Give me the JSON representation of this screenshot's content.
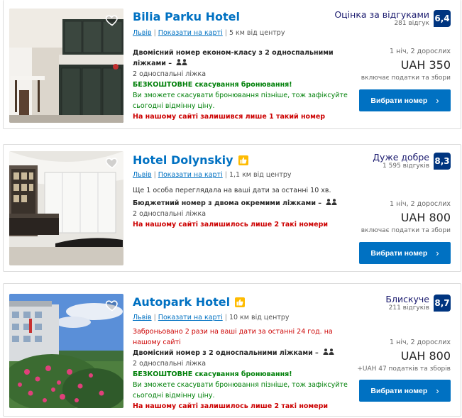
{
  "hotels": [
    {
      "name": "Bilia Parku Hotel",
      "city": "Львів",
      "map_link": "Показати на карті",
      "distance": "5 км від центру",
      "room_name": "Двомісний номер економ-класу з 2 односпальними ліжками –",
      "beds": "2 односпальні ліжка",
      "free_cancel": "БЕЗКОШТОВНЕ скасування бронювання!",
      "cancel_note": "Ви зможете скасувати бронювання пізніше, тож зафіксуйте сьогодні відмінну ціну.",
      "scarcity": "На нашому сайті залишився лише 1 такий номер",
      "review_word": "Оцінка за відгуками",
      "review_count": "281 відгук",
      "score": "6,4",
      "occupancy": "1 ніч, 2 дорослих",
      "price": "UAH 350",
      "tax": "включає податки та збори",
      "button": "Вибрати номер"
    },
    {
      "name": "Hotel Dolynskiy",
      "city": "Львів",
      "map_link": "Показати на карті",
      "distance": "1,1 км від центру",
      "viewers": "Ще 1 особа переглядала на ваші дати за останні 10 хв.",
      "room_name": "Бюджетний номер з двома окремими ліжками –",
      "beds": "2 односпальні ліжка",
      "scarcity": "На нашому сайті залишилось лише 2 такі номери",
      "review_word": "Дуже добре",
      "review_count": "1 595 відгуків",
      "score": "8,3",
      "occupancy": "1 ніч, 2 дорослих",
      "price": "UAH 800",
      "tax": "включає податки та збори",
      "button": "Вибрати номер"
    },
    {
      "name": "Autopark Hotel",
      "city": "Львів",
      "map_link": "Показати на карті",
      "distance": "10 км від центру",
      "booked_note": "Заброньовано 2 рази на ваші дати за останні 24 год. на нашому сайті",
      "room_name": "Двомісний номер з 2 односпальними ліжками –",
      "beds": "2 односпальні ліжка",
      "free_cancel": "БЕЗКОШТОВНЕ скасування бронювання!",
      "cancel_note": "Ви зможете скасувати бронювання пізніше, тож зафіксуйте сьогодні відмінну ціну.",
      "scarcity": "На нашому сайті залишилось лише 2 такі номери",
      "review_word": "Блискуче",
      "review_count": "211 відгуків",
      "score": "8,7",
      "occupancy": "1 ніч, 2 дорослих",
      "price": "UAH 800",
      "tax": "+UAH 47 податків та зборів",
      "button": "Вибрати номер"
    }
  ],
  "colors": {
    "link": "#0071c2",
    "score_bg": "#003580",
    "green": "#008009",
    "red": "#cc0000",
    "badge": "#febb02"
  },
  "icons": [
    "heart-icon",
    "thumbs-up-badge-icon",
    "two-persons-icon",
    "chevron-right-icon"
  ]
}
